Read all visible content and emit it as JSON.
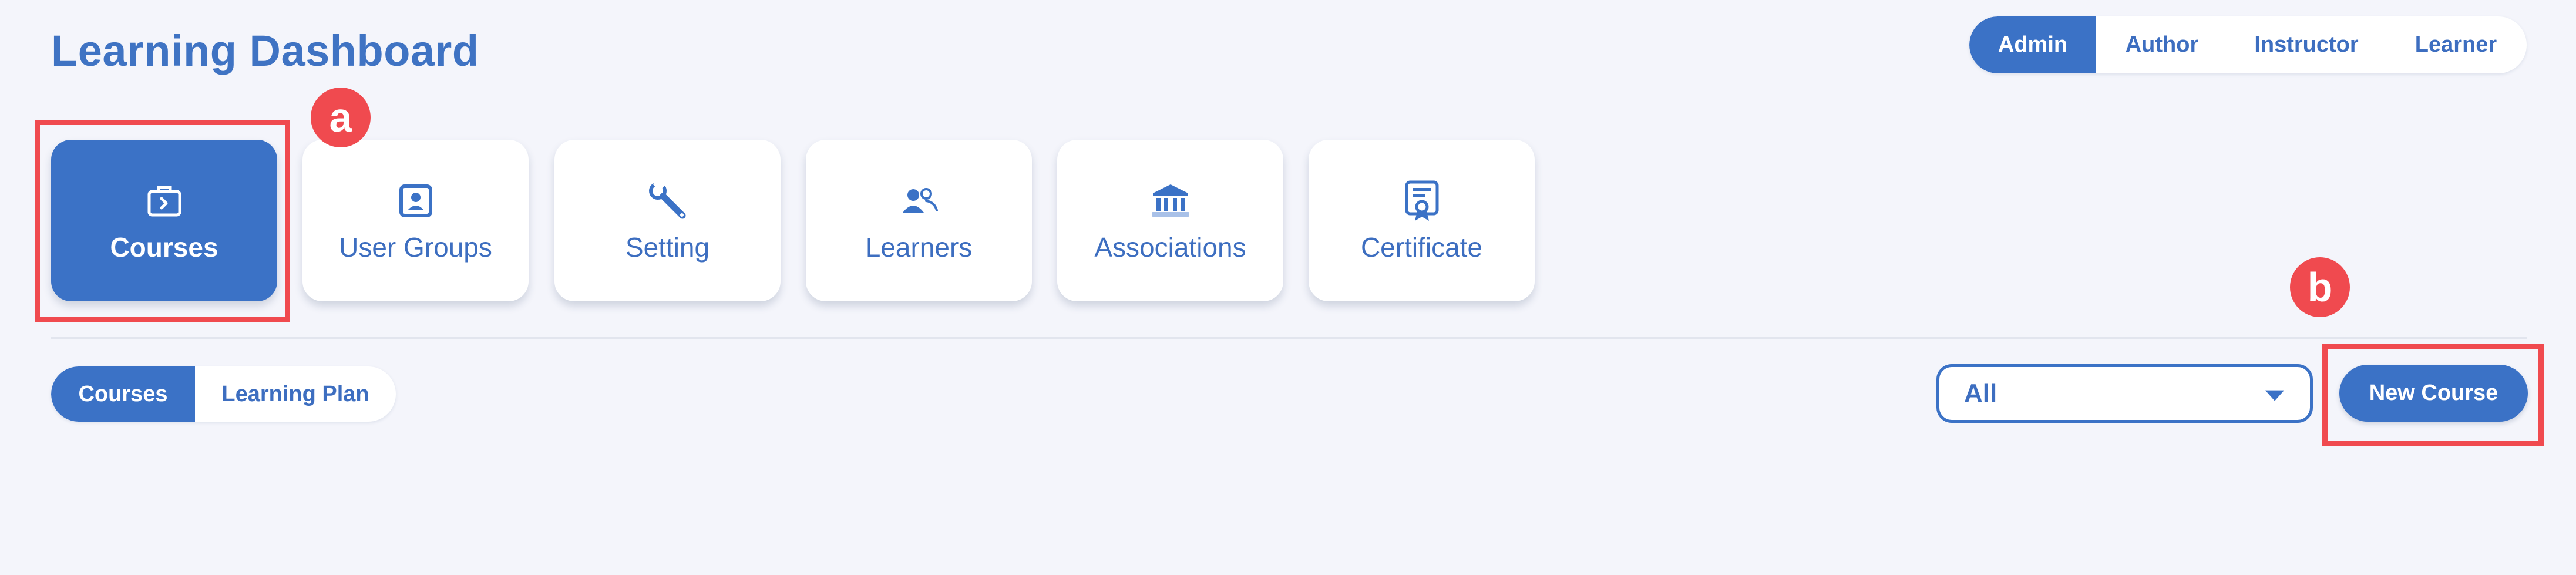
{
  "header": {
    "title": "Learning Dashboard"
  },
  "roles": {
    "items": [
      {
        "label": "Admin",
        "active": true
      },
      {
        "label": "Author",
        "active": false
      },
      {
        "label": "Instructor",
        "active": false
      },
      {
        "label": "Learner",
        "active": false
      }
    ]
  },
  "tiles": {
    "items": [
      {
        "label": "Courses",
        "icon": "briefcase-icon",
        "active": true
      },
      {
        "label": "User Groups",
        "icon": "id-badge-icon",
        "active": false
      },
      {
        "label": "Setting",
        "icon": "wrench-icon",
        "active": false
      },
      {
        "label": "Learners",
        "icon": "people-icon",
        "active": false
      },
      {
        "label": "Associations",
        "icon": "institution-icon",
        "active": false
      },
      {
        "label": "Certificate",
        "icon": "certificate-icon",
        "active": false
      }
    ]
  },
  "annotations": {
    "a": "a",
    "b": "b"
  },
  "subtabs": {
    "items": [
      {
        "label": "Courses",
        "active": true
      },
      {
        "label": "Learning Plan",
        "active": false
      }
    ]
  },
  "filter": {
    "selected": "All"
  },
  "actions": {
    "new_course": "New Course"
  },
  "colors": {
    "primary": "#3b72c6",
    "title": "#3f73c3",
    "highlight": "#f04a4f",
    "background": "#f4f5fb"
  }
}
